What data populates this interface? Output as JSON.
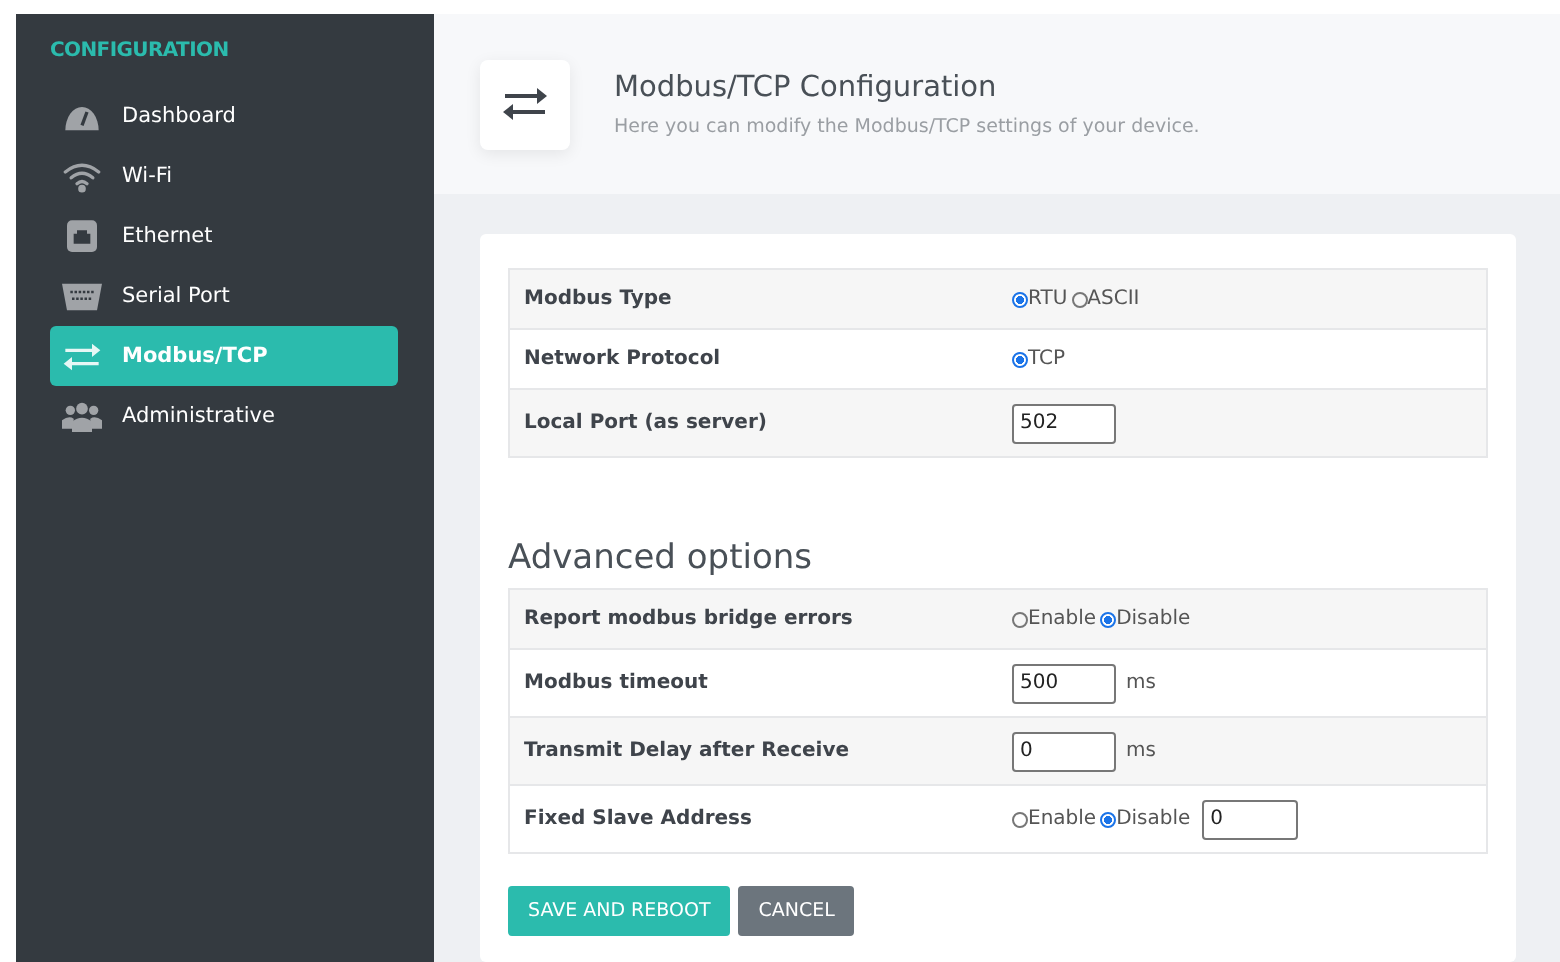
{
  "sidebar": {
    "heading": "CONFIGURATION",
    "items": [
      {
        "label": "Dashboard",
        "kind": "gauge",
        "selected": false
      },
      {
        "label": "Wi-Fi",
        "kind": "wifi",
        "selected": false
      },
      {
        "label": "Ethernet",
        "kind": "ethernet",
        "selected": false
      },
      {
        "label": "Serial Port",
        "kind": "serial",
        "selected": false
      },
      {
        "label": "Modbus/TCP",
        "kind": "arrows",
        "selected": true
      },
      {
        "label": "Administrative",
        "kind": "users",
        "selected": false
      }
    ]
  },
  "header": {
    "title": "Modbus/TCP Configuration",
    "subtitle": "Here you can modify the Modbus/TCP settings of your device."
  },
  "settings": [
    {
      "label": "Modbus Type",
      "kind": "radio",
      "options": [
        {
          "label": "RTU",
          "selected": true
        },
        {
          "label": "ASCII",
          "selected": false
        }
      ]
    },
    {
      "label": "Network Protocol",
      "kind": "radio",
      "options": [
        {
          "label": "TCP",
          "selected": true
        }
      ]
    },
    {
      "label": "Local Port (as server)",
      "kind": "input",
      "value": "502"
    }
  ],
  "advanced": {
    "title": "Advanced options",
    "rows": [
      {
        "label": "Report modbus bridge errors",
        "kind": "radio",
        "options": [
          {
            "label": "Enable",
            "selected": false
          },
          {
            "label": "Disable",
            "selected": true
          }
        ]
      },
      {
        "label": "Modbus timeout",
        "kind": "input",
        "value": "500",
        "unit": "ms"
      },
      {
        "label": "Transmit Delay after Receive",
        "kind": "input",
        "value": "0",
        "unit": "ms"
      },
      {
        "label": "Fixed Slave Address",
        "kind": "radio_input",
        "options": [
          {
            "label": "Enable",
            "selected": false
          },
          {
            "label": "Disable",
            "selected": true
          }
        ],
        "value": "0"
      }
    ]
  },
  "buttons": [
    {
      "label": "SAVE AND REBOOT",
      "kind": "primary"
    },
    {
      "label": "CANCEL",
      "kind": "secondary"
    }
  ]
}
